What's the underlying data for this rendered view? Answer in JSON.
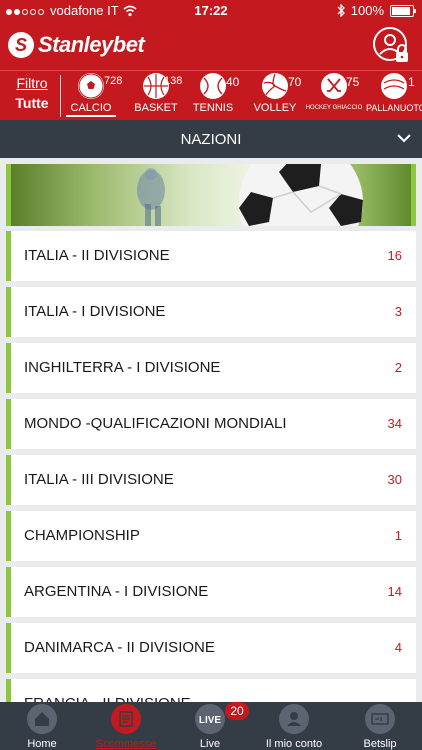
{
  "status": {
    "carrier": "vodafone IT",
    "time": "17:22",
    "battery": "100%",
    "battery_level": 1.0
  },
  "brand": {
    "name": "Stanleybet"
  },
  "filter": {
    "label": "Filtro",
    "value": "Tutte"
  },
  "sports": [
    {
      "label": "CALCIO",
      "count": "728",
      "icon": "soccer-ball-icon",
      "active": true
    },
    {
      "label": "BASKET",
      "count": "138",
      "icon": "basketball-icon"
    },
    {
      "label": "TENNIS",
      "count": "40",
      "icon": "tennis-ball-icon"
    },
    {
      "label": "VOLLEY",
      "count": "70",
      "icon": "volleyball-icon"
    },
    {
      "label": "HOCKEY GHIACCIO",
      "count": "75",
      "icon": "hockey-sticks-icon"
    },
    {
      "label": "PALLANUOTO",
      "count": "1",
      "icon": "water-polo-icon"
    }
  ],
  "section": {
    "title": "NAZIONI"
  },
  "leagues": [
    {
      "name": "ITALIA - II DIVISIONE",
      "count": "16"
    },
    {
      "name": "ITALIA - I DIVISIONE",
      "count": "3"
    },
    {
      "name": "INGHILTERRA - I DIVISIONE",
      "count": "2"
    },
    {
      "name": "MONDO -QUALIFICAZIONI MONDIALI",
      "count": "34"
    },
    {
      "name": "ITALIA - III DIVISIONE",
      "count": "30"
    },
    {
      "name": "CHAMPIONSHIP",
      "count": "1"
    },
    {
      "name": "ARGENTINA - I DIVISIONE",
      "count": "14"
    },
    {
      "name": "DANIMARCA - II DIVISIONE",
      "count": "4"
    },
    {
      "name": "FRANCIA - II DIVISIONE",
      "count": ""
    }
  ],
  "tabs": [
    {
      "label": "Home",
      "icon": "home-icon"
    },
    {
      "label": "Scommesse",
      "icon": "betting-coupon-icon",
      "active": true
    },
    {
      "label": "Live",
      "icon": "live-icon",
      "badge": "20"
    },
    {
      "label": "Il mio conto",
      "icon": "user-icon"
    },
    {
      "label": "Betslip",
      "icon": "betslip-icon"
    }
  ],
  "colors": {
    "brand_red": "#c41a1f",
    "dark_bar": "#343c46",
    "accent_green": "#8dc63f"
  }
}
